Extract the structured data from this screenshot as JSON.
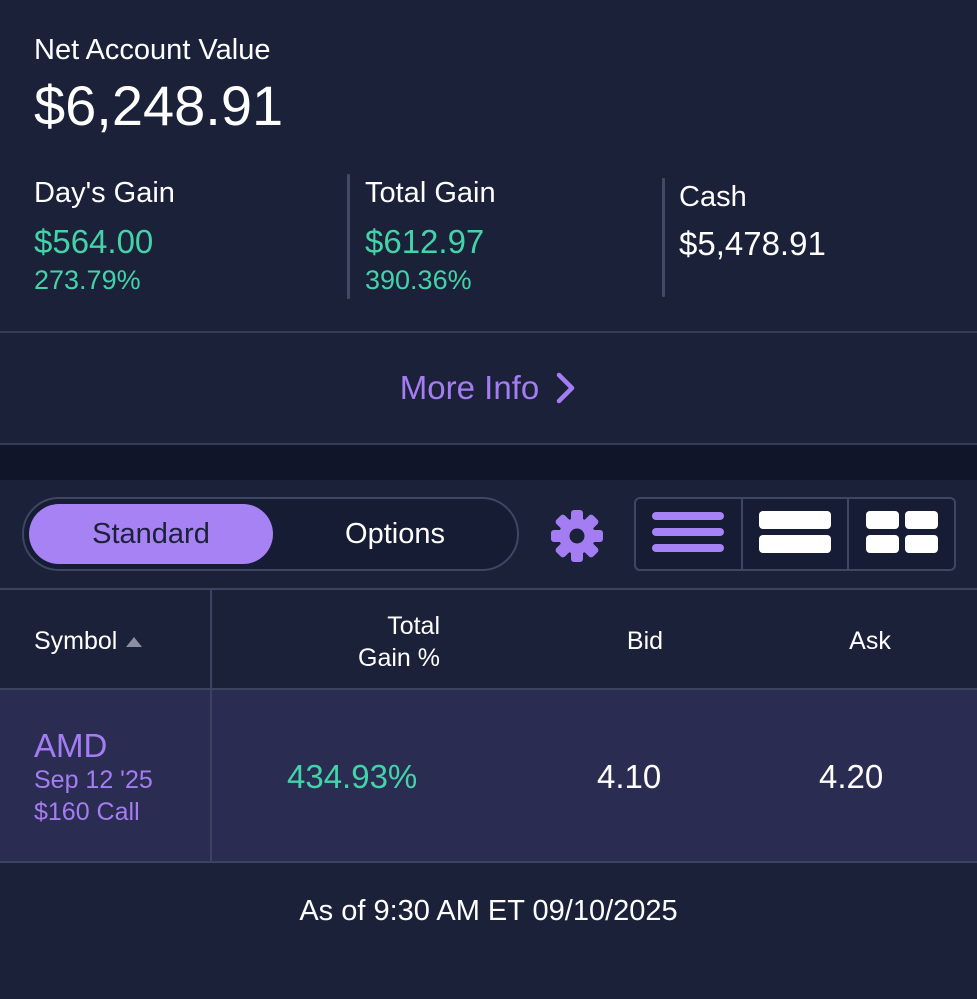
{
  "summary": {
    "net_account_value_label": "Net Account Value",
    "net_account_value": "$6,248.91",
    "days_gain": {
      "label": "Day's Gain",
      "amount": "$564.00",
      "percent": "273.79%"
    },
    "total_gain": {
      "label": "Total Gain",
      "amount": "$612.97",
      "percent": "390.36%"
    },
    "cash": {
      "label": "Cash",
      "amount": "$5,478.91"
    },
    "more_info_label": "More Info"
  },
  "controls": {
    "segment": {
      "standard_label": "Standard",
      "options_label": "Options",
      "selected": "Standard"
    },
    "settings_icon": "gear-icon",
    "view_modes": [
      "list-view-icon",
      "rows-view-icon",
      "grid-view-icon"
    ]
  },
  "table": {
    "headers": {
      "symbol": "Symbol",
      "total_gain_line1": "Total",
      "total_gain_line2": "Gain %",
      "bid": "Bid",
      "ask": "Ask"
    },
    "sort": {
      "column": "Symbol",
      "direction": "ascending"
    },
    "rows": [
      {
        "ticker": "AMD",
        "expiry": "Sep 12 '25",
        "contract": "$160 Call",
        "total_gain_pct": "434.93%",
        "bid": "4.10",
        "ask": "4.20"
      }
    ]
  },
  "footer": {
    "as_of": "As of 9:30 AM ET 09/10/2025"
  },
  "colors": {
    "background": "#1b2139",
    "accent": "#a782f4",
    "gain": "#43d3a9",
    "row_highlight": "#2b2c52"
  }
}
